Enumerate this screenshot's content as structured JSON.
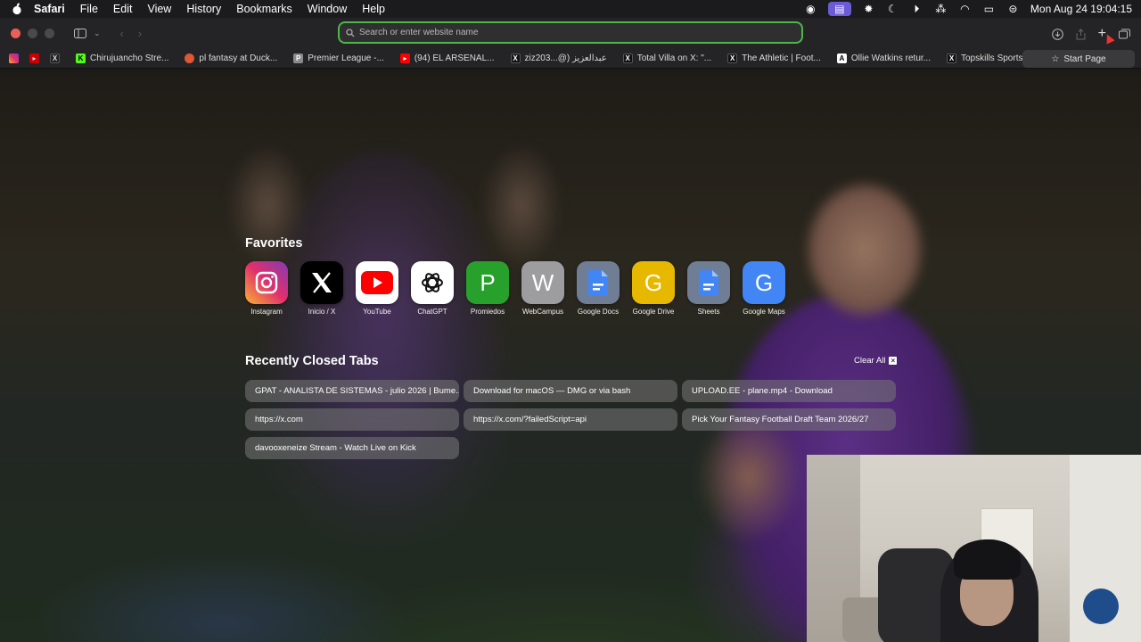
{
  "menubar": {
    "app_name": "Safari",
    "items": [
      "File",
      "Edit",
      "View",
      "History",
      "Bookmarks",
      "Window",
      "Help"
    ],
    "datetime": "Mon Aug 24  19:04:15"
  },
  "toolbar": {
    "search_placeholder": "Search or enter website name",
    "url_value": ""
  },
  "bookmarks": {
    "items": [
      {
        "label": "Chirujuancho Stre...",
        "icon": "kick-icon",
        "color": "#53fc18"
      },
      {
        "label": "pl fantasy at Duck...",
        "icon": "duckduckgo-icon",
        "color": "#de5833"
      },
      {
        "label": "Premier League -...",
        "icon": "page-icon",
        "color": "#8a8a8a"
      },
      {
        "label": "(94) EL ARSENAL...",
        "icon": "youtube-icon",
        "color": "#ff0000"
      },
      {
        "label": "ziz203...@) عبدالعزيز",
        "icon": "x-icon",
        "color": "#000000"
      },
      {
        "label": "Total Villa on X: \"...",
        "icon": "x-icon",
        "color": "#000000",
        "bold_prefix": "Total Villa"
      },
      {
        "label": "The Athletic | Foot...",
        "icon": "x-icon",
        "color": "#000000"
      },
      {
        "label": "Ollie Watkins retur...",
        "icon": "athletic-icon",
        "color": "#ffffff"
      },
      {
        "label": "Topskills Sports U...",
        "icon": "x-icon",
        "color": "#000000"
      }
    ],
    "start_page_label": "Start Page"
  },
  "favorites": {
    "title": "Favorites",
    "items": [
      {
        "label": "Instagram",
        "glyph": "◎",
        "icon": "instagram-icon",
        "bg": "linear-gradient(45deg,#f9b233,#e1306c,#833ab4)"
      },
      {
        "label": "Inicio / X",
        "glyph": "𝕏",
        "icon": "x-icon",
        "bg": "#000000"
      },
      {
        "label": "YouTube",
        "glyph": "▶",
        "icon": "youtube-icon",
        "bg": "#ff0000"
      },
      {
        "label": "ChatGPT",
        "glyph": "✺",
        "icon": "chatgpt-icon",
        "bg": "#ffffff"
      },
      {
        "label": "Promiedos",
        "glyph": "P",
        "icon": "letter-p-icon",
        "bg": "#27a02c"
      },
      {
        "label": "WebCampus",
        "glyph": "W",
        "icon": "letter-w-icon",
        "bg": "#9d9d9f"
      },
      {
        "label": "Google Docs",
        "glyph": "▬",
        "icon": "google-docs-icon",
        "bg": "#4285f4"
      },
      {
        "label": "Google Drive",
        "glyph": "G",
        "icon": "letter-g-icon",
        "bg": "#e6b800"
      },
      {
        "label": "Sheets",
        "glyph": "▬",
        "icon": "sheets-icon",
        "bg": "#4285f4"
      },
      {
        "label": "Google Maps",
        "glyph": "G",
        "icon": "letter-g-icon",
        "bg": "#4285f4"
      }
    ]
  },
  "recently_closed": {
    "title": "Recently Closed Tabs",
    "clear_label": "Clear All",
    "tabs": [
      "GPAT - ANALISTA DE SISTEMAS - julio 2026 | Bume...",
      "Download for macOS — DMG or via bash",
      "UPLOAD.EE - plane.mp4 - Download",
      "https://x.com",
      "https://x.com/?failedScript=api",
      "Pick Your Fantasy Football Draft Team 2026/27",
      "davooxeneize Stream - Watch Live on Kick"
    ]
  }
}
